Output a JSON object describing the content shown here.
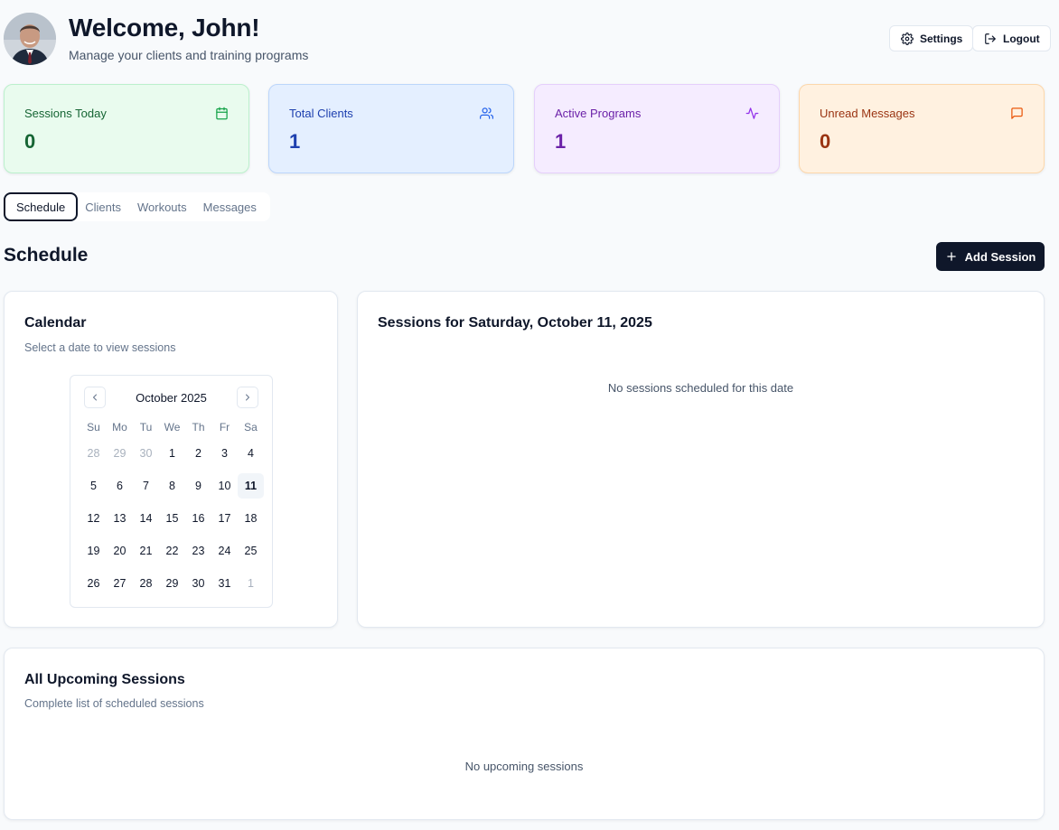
{
  "header": {
    "welcome": "Welcome, John!",
    "subtitle": "Manage your clients and training programs",
    "settings_label": "Settings",
    "logout_label": "Logout"
  },
  "stats": [
    {
      "label": "Sessions Today",
      "value": "0",
      "icon": "calendar-icon",
      "color": "#166534"
    },
    {
      "label": "Total Clients",
      "value": "1",
      "icon": "users-icon",
      "color": "#1e40af"
    },
    {
      "label": "Active Programs",
      "value": "1",
      "icon": "activity-icon",
      "color": "#6b21a8"
    },
    {
      "label": "Unread Messages",
      "value": "0",
      "icon": "message-icon",
      "color": "#9a3412"
    }
  ],
  "tabs": [
    {
      "label": "Schedule",
      "active": true
    },
    {
      "label": "Clients",
      "active": false
    },
    {
      "label": "Workouts",
      "active": false
    },
    {
      "label": "Messages",
      "active": false
    }
  ],
  "schedule": {
    "title": "Schedule",
    "add_session_label": "Add Session",
    "calendar_card": {
      "title": "Calendar",
      "description": "Select a date to view sessions"
    },
    "calendar": {
      "month_label": "October 2025",
      "weekdays": [
        "Su",
        "Mo",
        "Tu",
        "We",
        "Th",
        "Fr",
        "Sa"
      ],
      "weeks": [
        [
          "28",
          "29",
          "30",
          "1",
          "2",
          "3",
          "4"
        ],
        [
          "5",
          "6",
          "7",
          "8",
          "9",
          "10",
          "11"
        ],
        [
          "12",
          "13",
          "14",
          "15",
          "16",
          "17",
          "18"
        ],
        [
          "19",
          "20",
          "21",
          "22",
          "23",
          "24",
          "25"
        ],
        [
          "26",
          "27",
          "28",
          "29",
          "30",
          "31",
          "1"
        ]
      ],
      "selected_day": "11"
    },
    "sessions_card": {
      "title": "Sessions for Saturday, October 11, 2025",
      "empty": "No sessions scheduled for this date"
    }
  },
  "upcoming": {
    "title": "All Upcoming Sessions",
    "description": "Complete list of scheduled sessions",
    "empty": "No upcoming sessions"
  },
  "accent_color": "#0f172a"
}
